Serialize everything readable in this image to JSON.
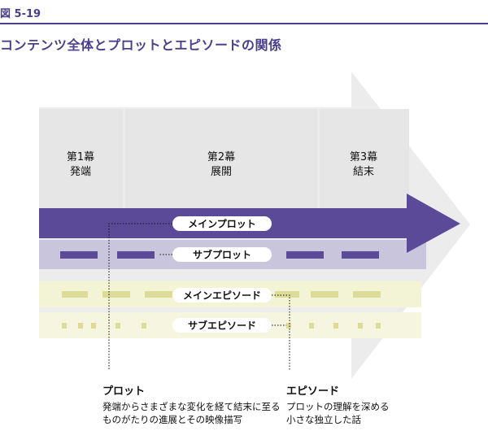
{
  "figure": {
    "label": "図 5-19",
    "title": "コンテンツ全体とプロットとエピソードの関係"
  },
  "colors": {
    "accent": "#4b3f8c",
    "arrow_gray": "#ececec",
    "phase_panel": "#e7e7e7",
    "main_plot": "#5a4a98",
    "sub_plot_band": "#c9c5dd",
    "episode_band": "#f3f3d6",
    "episode_dash": "#dede9a"
  },
  "phases": [
    {
      "line1": "第1幕",
      "line2": "発端"
    },
    {
      "line1": "第2幕",
      "line2": "展開"
    },
    {
      "line1": "第3幕",
      "line2": "結末"
    }
  ],
  "bands": {
    "main_plot": "メインプロット",
    "sub_plot": "サブプロット",
    "main_episode": "メインエピソード",
    "sub_episode": "サブエピソード"
  },
  "notes": {
    "plot": {
      "title": "プロット",
      "line1": "発端からさまざまな変化を経て結末に至る",
      "line2": "ものがたりの進展とその映像描写"
    },
    "episode": {
      "title": "エピソード",
      "line1": "プロットの理解を深める",
      "line2": "小さな独立した話"
    }
  }
}
